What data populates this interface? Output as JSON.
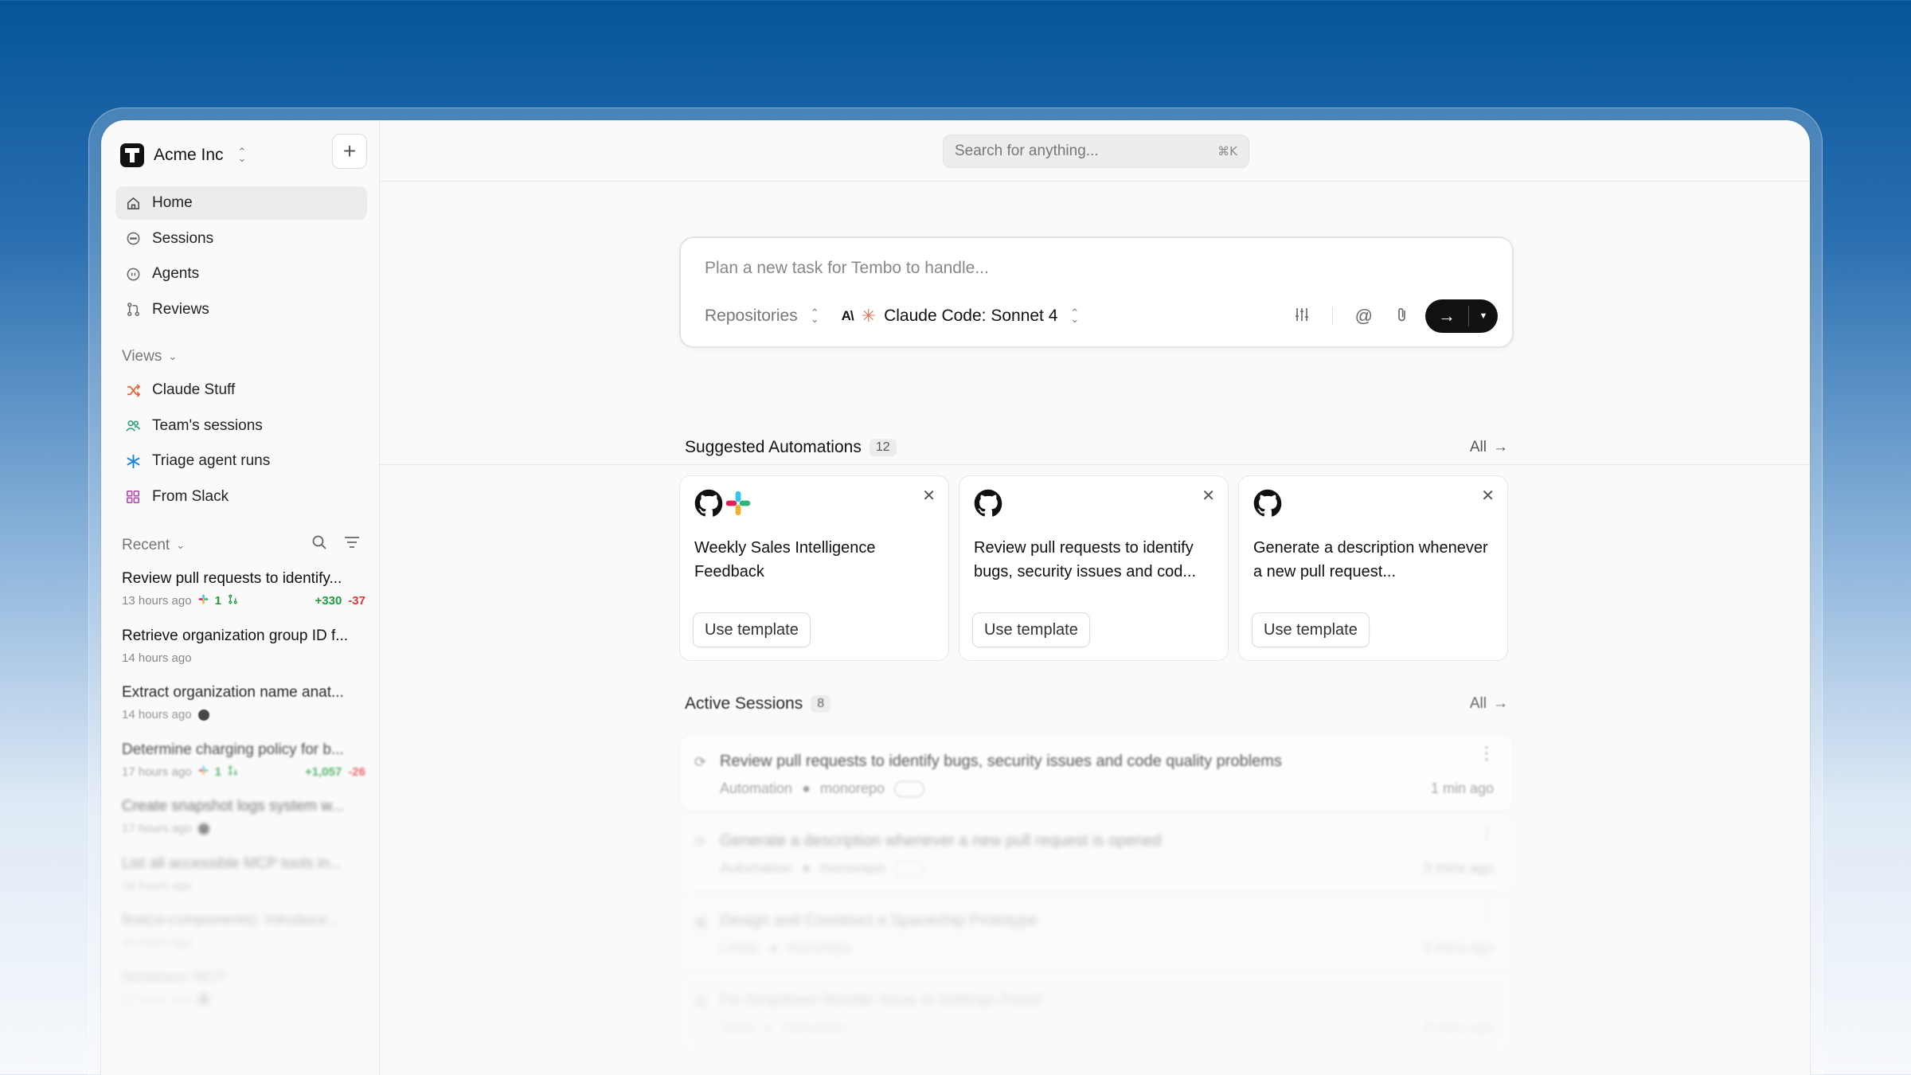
{
  "org": {
    "name": "Acme Inc"
  },
  "nav": [
    {
      "label": "Home",
      "icon": "home-icon"
    },
    {
      "label": "Sessions",
      "icon": "chat-icon"
    },
    {
      "label": "Agents",
      "icon": "agent-icon"
    },
    {
      "label": "Reviews",
      "icon": "pull-request-icon"
    }
  ],
  "views": {
    "label": "Views",
    "items": [
      {
        "label": "Claude Stuff",
        "icon": "shuffle-icon",
        "color": "#e8623a"
      },
      {
        "label": "Team's sessions",
        "icon": "users-icon",
        "color": "#1f9d6e"
      },
      {
        "label": "Triage agent runs",
        "icon": "asterisk-icon",
        "color": "#1a7fd6"
      },
      {
        "label": "From Slack",
        "icon": "grid-icon",
        "color": "#b24ab0"
      }
    ]
  },
  "recent": {
    "label": "Recent",
    "items": [
      {
        "title": "Review pull requests to identify...",
        "time": "13 hours ago",
        "prs": "1",
        "additions": "+330",
        "deletions": "-37"
      },
      {
        "title": "Retrieve organization group ID f...",
        "time": "14 hours ago"
      },
      {
        "title": "Extract organization name anat...",
        "time": "14 hours ago"
      },
      {
        "title": "Determine charging policy for b...",
        "time": "17 hours ago",
        "prs": "1",
        "additions": "+1,057",
        "deletions": "-26"
      },
      {
        "title": "Create snapshot logs system w...",
        "time": "17 hours ago"
      },
      {
        "title": "List all accessible MCP tools in...",
        "time": "18 hours ago"
      },
      {
        "title": "feat(ui-components): Introduce...",
        "time": "20 hours ago"
      },
      {
        "title": "Metabase MCP",
        "time": "22 hours ago"
      }
    ]
  },
  "search": {
    "placeholder": "Search for anything...",
    "shortcut": "⌘K"
  },
  "composer": {
    "placeholder": "Plan a new task for Tembo to handle...",
    "repositories_label": "Repositories",
    "model_logo": "A\\",
    "model_label": "Claude Code: Sonnet 4"
  },
  "automations": {
    "title": "Suggested Automations",
    "count": "12",
    "all_label": "All",
    "cards": [
      {
        "title": "Weekly Sales Intelligence Feedback",
        "button": "Use template",
        "icons": [
          "github-icon",
          "slack-icon"
        ]
      },
      {
        "title": "Review pull requests to identify bugs, security issues and cod...",
        "button": "Use template",
        "icons": [
          "github-icon"
        ]
      },
      {
        "title": "Generate a description whenever a new pull request...",
        "button": "Use template",
        "icons": [
          "github-icon"
        ]
      }
    ]
  },
  "active_sessions": {
    "title": "Active Sessions",
    "count": "8",
    "all_label": "All",
    "items": [
      {
        "title": "Review pull requests to identify bugs, security issues and code quality problems",
        "source": "Automation",
        "repo": "monorepo",
        "time": "1 min ago"
      },
      {
        "title": "Generate a description whenever a new pull request is opened",
        "source": "Automation",
        "repo": "monorepo",
        "time": "3 mins ago"
      },
      {
        "title": "Design and Construct a Spaceship Prototype",
        "source": "Linear",
        "repo": "monorepo",
        "time": "5 mins ago"
      },
      {
        "title": "Fix Dropdown Render Issue in Settings Panel",
        "source": "Slack",
        "repo": "monorepo",
        "time": "8 mins ago"
      }
    ]
  },
  "colors": {
    "accent": "#111111",
    "add": "#1f9d3e",
    "delete": "#e0353b",
    "claude": "#d97757"
  }
}
